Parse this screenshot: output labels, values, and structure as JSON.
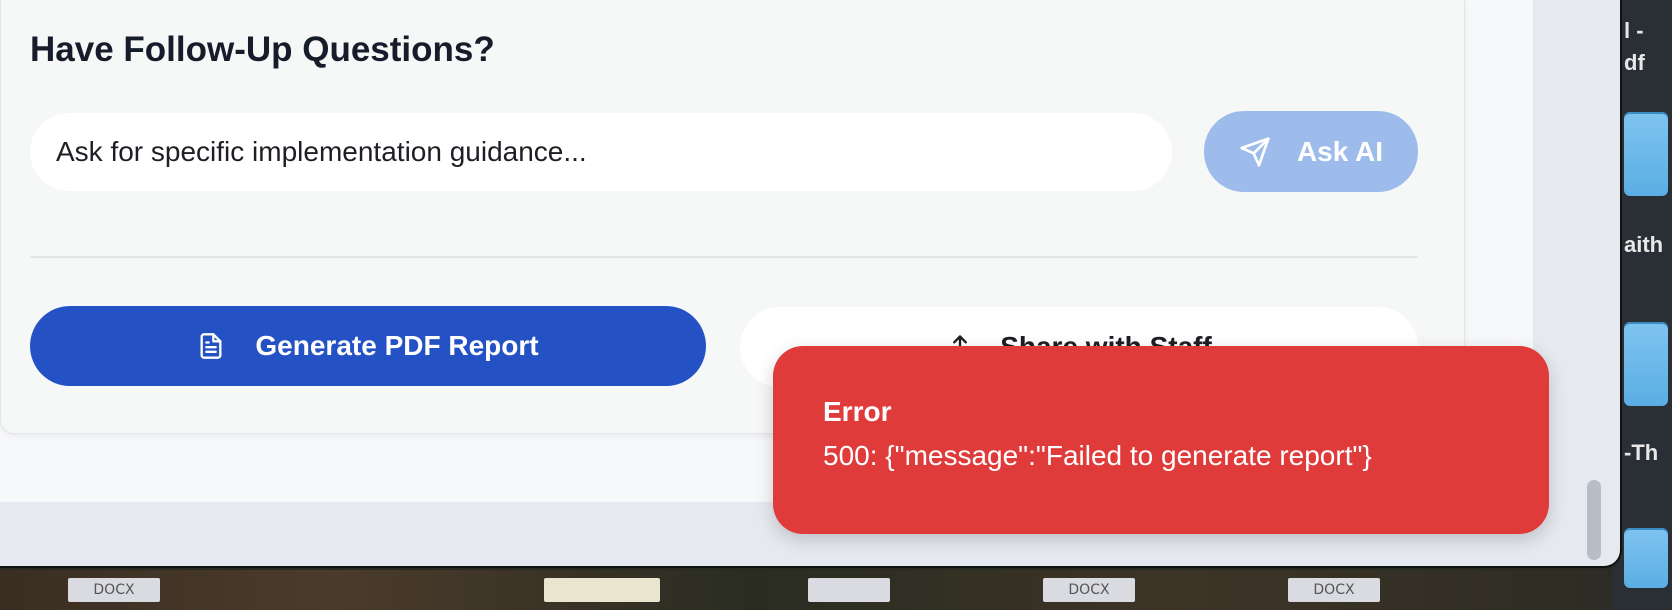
{
  "followup": {
    "title": "Have Follow-Up Questions?",
    "input_placeholder": "Ask for specific implementation guidance...",
    "ask_label": "Ask AI"
  },
  "actions": {
    "generate_label": "Generate PDF Report",
    "share_label": "Share with Staff"
  },
  "toast": {
    "title": "Error",
    "message": "500: {\"message\":\"Failed to generate report\"}"
  },
  "desktop": {
    "files": [
      "DOCX",
      "DOCX",
      "DOCX"
    ],
    "side_labels": [
      "l -",
      "df",
      "aith",
      "-Th"
    ]
  },
  "colors": {
    "primary": "#2451c4",
    "ask_disabled": "#9dbceb",
    "error": "#e03b3b"
  }
}
